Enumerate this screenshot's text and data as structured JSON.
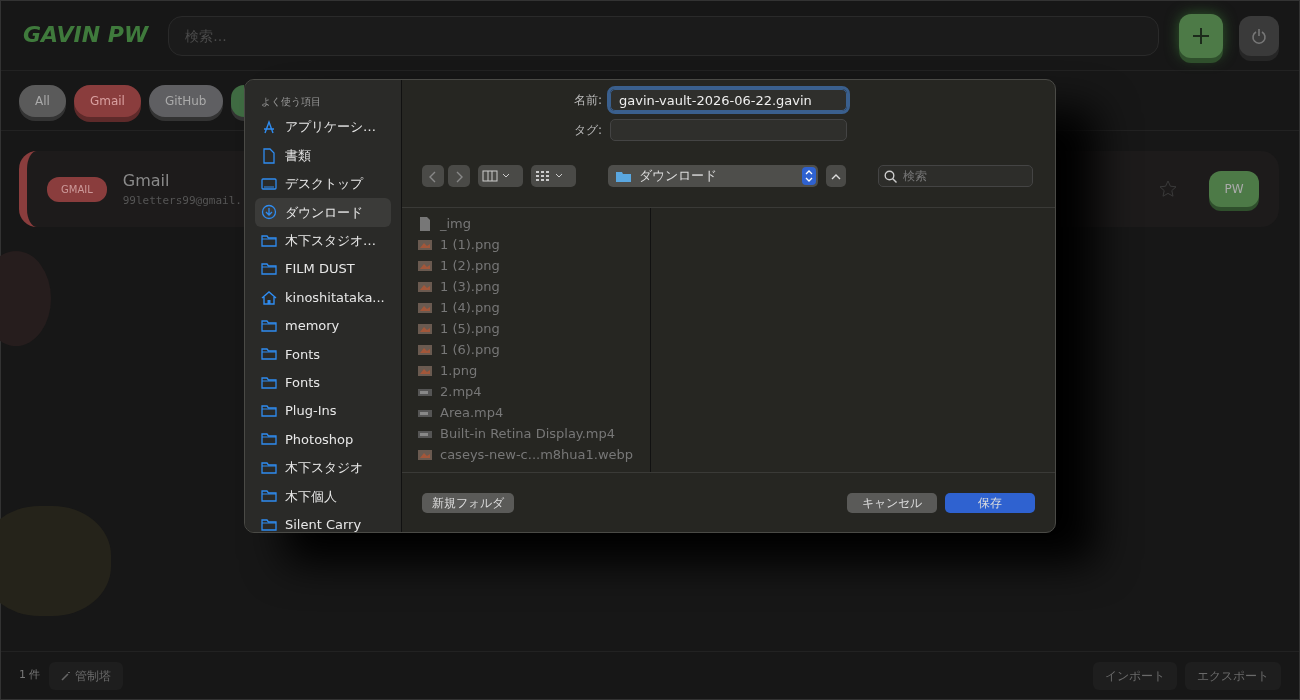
{
  "app": {
    "logo": "GAVIN PW",
    "search": {
      "placeholder": "検索..."
    }
  },
  "filters": [
    {
      "label": "All",
      "color": "#5a5a5a",
      "selected": false
    },
    {
      "label": "Gmail",
      "color": "#8a3d3d",
      "selected": true
    },
    {
      "label": "GitHub",
      "color": "#5f5f62",
      "selected": false
    },
    {
      "color": "#3f6b42",
      "selected": false
    }
  ],
  "entries": [
    {
      "tag": "GMAIL",
      "color": "#8a3d3d",
      "title": "Gmail",
      "email": "99letters99@gmail.",
      "starred": false,
      "action": "PW"
    }
  ],
  "footer": {
    "count": "1 件",
    "admin": "管制塔",
    "import": "インポート",
    "export": "エクスポート"
  },
  "dialog": {
    "sidebar_title": "よく使う項目",
    "places": [
      {
        "kind": "apps",
        "label": "アプリケーシ…",
        "selected": false
      },
      {
        "kind": "doc",
        "label": "書類",
        "selected": false
      },
      {
        "kind": "desktop",
        "label": "デスクトップ",
        "selected": false
      },
      {
        "kind": "download",
        "label": "ダウンロード",
        "selected": true
      },
      {
        "kind": "folder",
        "label": "木下スタジオ…",
        "selected": false
      },
      {
        "kind": "folder",
        "label": "FILM DUST",
        "selected": false
      },
      {
        "kind": "home",
        "label": "kinoshitataka...",
        "selected": false
      },
      {
        "kind": "folder",
        "label": "memory",
        "selected": false
      },
      {
        "kind": "folder",
        "label": "Fonts",
        "selected": false
      },
      {
        "kind": "folder",
        "label": "Fonts",
        "selected": false
      },
      {
        "kind": "folder",
        "label": "Plug-Ins",
        "selected": false
      },
      {
        "kind": "folder",
        "label": "Photoshop",
        "selected": false
      },
      {
        "kind": "folder",
        "label": "木下スタジオ",
        "selected": false
      },
      {
        "kind": "folder",
        "label": "木下個人",
        "selected": false
      },
      {
        "kind": "folder",
        "label": "Silent Carry",
        "selected": false
      }
    ],
    "name_label": "名前:",
    "name_value": "gavin-vault-2026-06-22.gavin",
    "tag_label": "タグ:",
    "location": "ダウンロード",
    "search": {
      "placeholder": "検索"
    },
    "files": [
      {
        "kind": "doc",
        "name": "_img"
      },
      {
        "kind": "image",
        "name": "1 (1).png"
      },
      {
        "kind": "image",
        "name": "1 (2).png"
      },
      {
        "kind": "image",
        "name": "1 (3).png"
      },
      {
        "kind": "image",
        "name": "1 (4).png"
      },
      {
        "kind": "image",
        "name": "1 (5).png"
      },
      {
        "kind": "image",
        "name": "1 (6).png"
      },
      {
        "kind": "image",
        "name": "1.png"
      },
      {
        "kind": "video",
        "name": "2.mp4"
      },
      {
        "kind": "video",
        "name": "Area.mp4"
      },
      {
        "kind": "video",
        "name": "Built-in Retina Display.mp4"
      },
      {
        "kind": "image",
        "name": "caseys-new-c...m8hua1.webp"
      }
    ],
    "new_folder": "新規フォルダ",
    "cancel": "キャンセル",
    "save": "保存"
  }
}
